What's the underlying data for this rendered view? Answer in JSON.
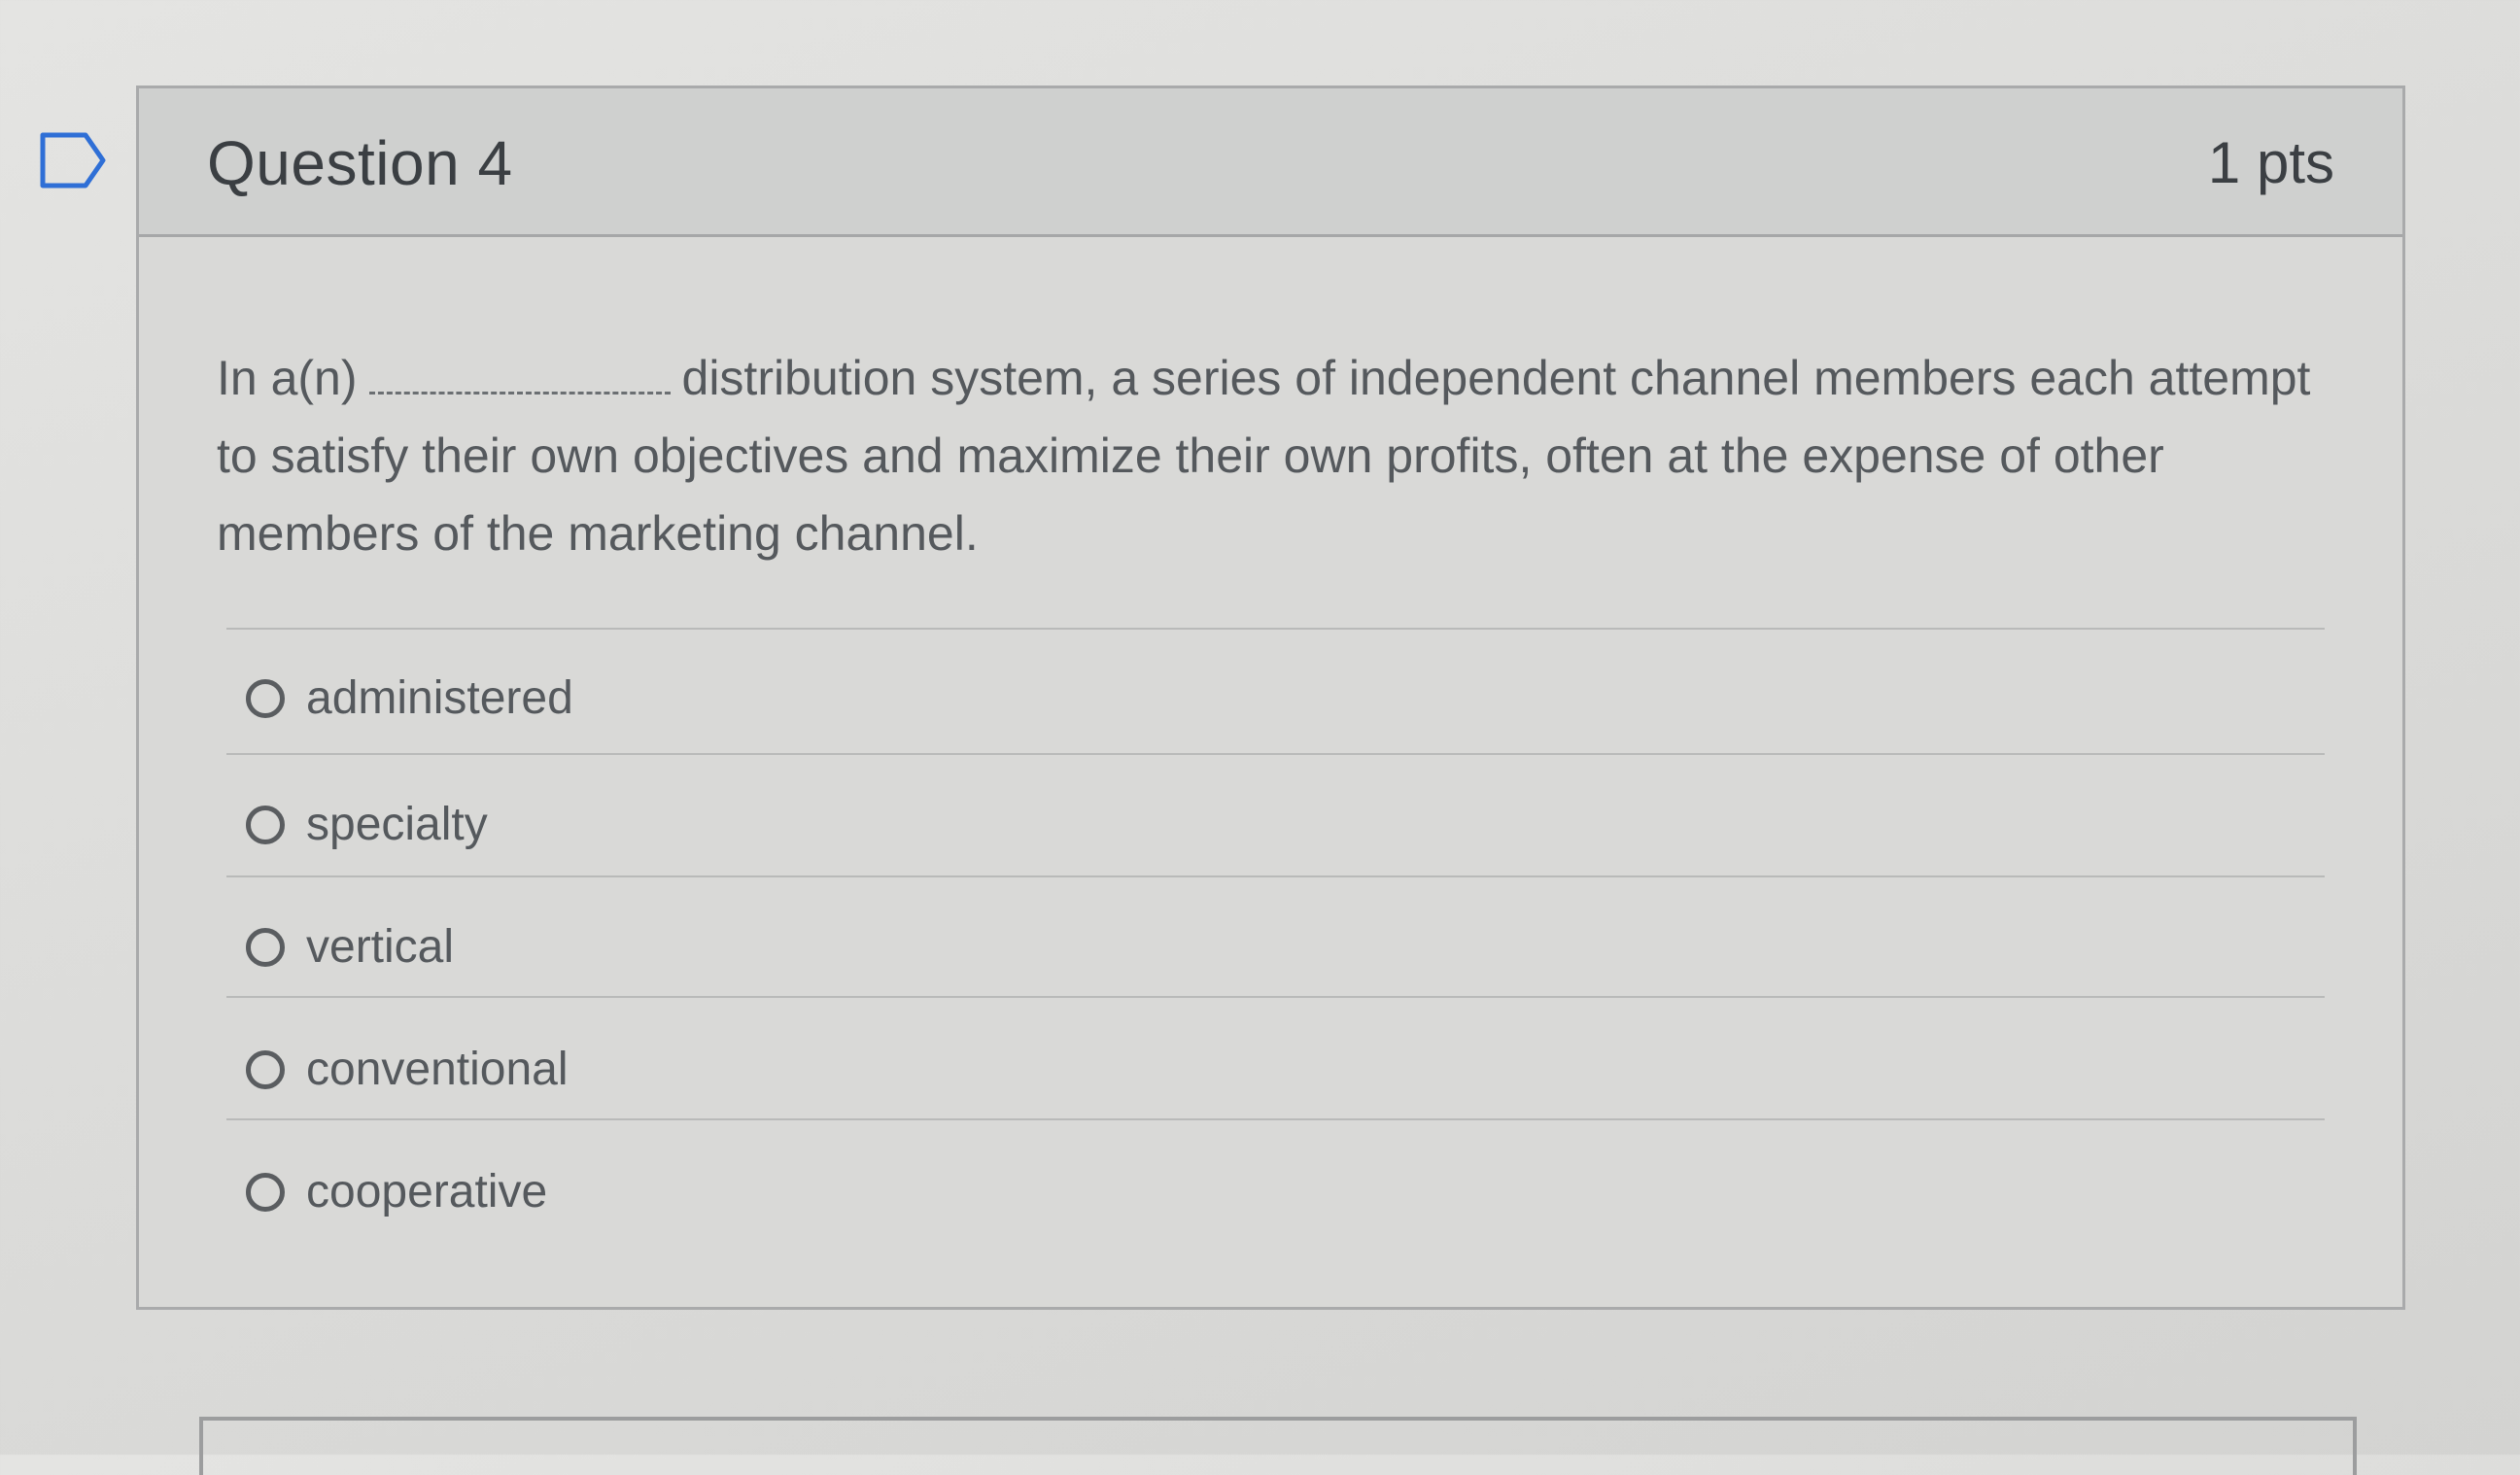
{
  "question": {
    "title": "Question 4",
    "points": "1 pts",
    "text_before_blank": "In a(n)",
    "text_after_blank": "distribution system, a series of independent channel members each attempt to satisfy their own objectives and maximize their own profits, often at the expense of other members of the marketing channel.",
    "flag_icon": "bookmark-flag-icon"
  },
  "answers": [
    {
      "label": "administered",
      "selected": false
    },
    {
      "label": "specialty",
      "selected": false
    },
    {
      "label": "vertical",
      "selected": false
    },
    {
      "label": "conventional",
      "selected": false
    },
    {
      "label": "cooperative",
      "selected": false
    }
  ],
  "colors": {
    "page_bg": "#dcdcda",
    "header_bg": "#cfd0cf",
    "border": "#a9aaab",
    "text": "#55595d"
  }
}
